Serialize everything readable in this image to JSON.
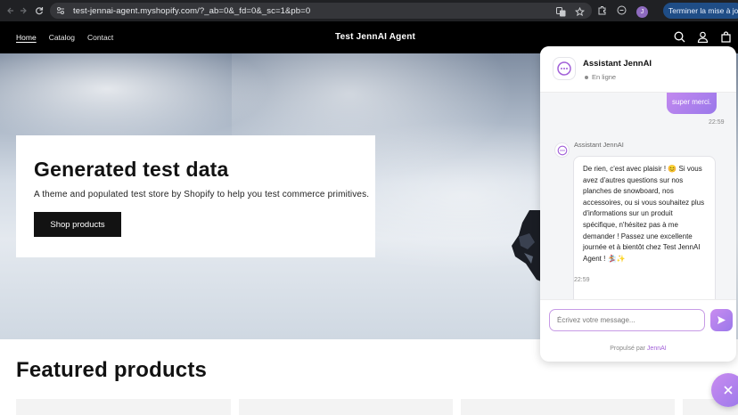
{
  "browser": {
    "url": "test-jennai-agent.myshopify.com/?_ab=0&_fd=0&_sc=1&pb=0",
    "profile_initial": "J",
    "update_label": "Terminer la mise à jour"
  },
  "store": {
    "nav": [
      "Home",
      "Catalog",
      "Contact"
    ],
    "brand": "Test JennAI Agent"
  },
  "hero": {
    "title": "Generated test data",
    "subtitle": "A theme and populated test store by Shopify to help you test commerce primitives.",
    "button_label": "Shop products"
  },
  "featured": {
    "title": "Featured products"
  },
  "chat": {
    "title": "Assistant JennAI",
    "status": "En ligne",
    "user_message": "super merci.",
    "user_time": "22:59",
    "bot_name": "Assistant JennAI",
    "bot_message": "De rien, c'est avec plaisir ! 😊 Si vous avez d'autres questions sur nos planches de snowboard, nos accessoires, ou si vous souhaitez plus d'informations sur un produit spécifique, n'hésitez pas à me demander ! Passez une excellente journée et à bientôt chez Test JennAI Agent ! 🏂✨",
    "bot_time": "22:59",
    "input_placeholder": "Écrivez votre message...",
    "powered_prefix": "Propulsé par",
    "powered_brand": "JennAI"
  },
  "colors": {
    "accent": "#b483ee",
    "header_bg": "#000000",
    "chrome_bg": "#202124"
  },
  "icons": [
    "back-icon",
    "forward-icon",
    "reload-icon",
    "site-settings-icon",
    "translate-icon",
    "bookmark-star-icon",
    "extensions-icon",
    "tab-search-icon",
    "search-icon",
    "account-icon",
    "cart-icon",
    "chat-dots-icon",
    "send-icon",
    "close-icon"
  ]
}
